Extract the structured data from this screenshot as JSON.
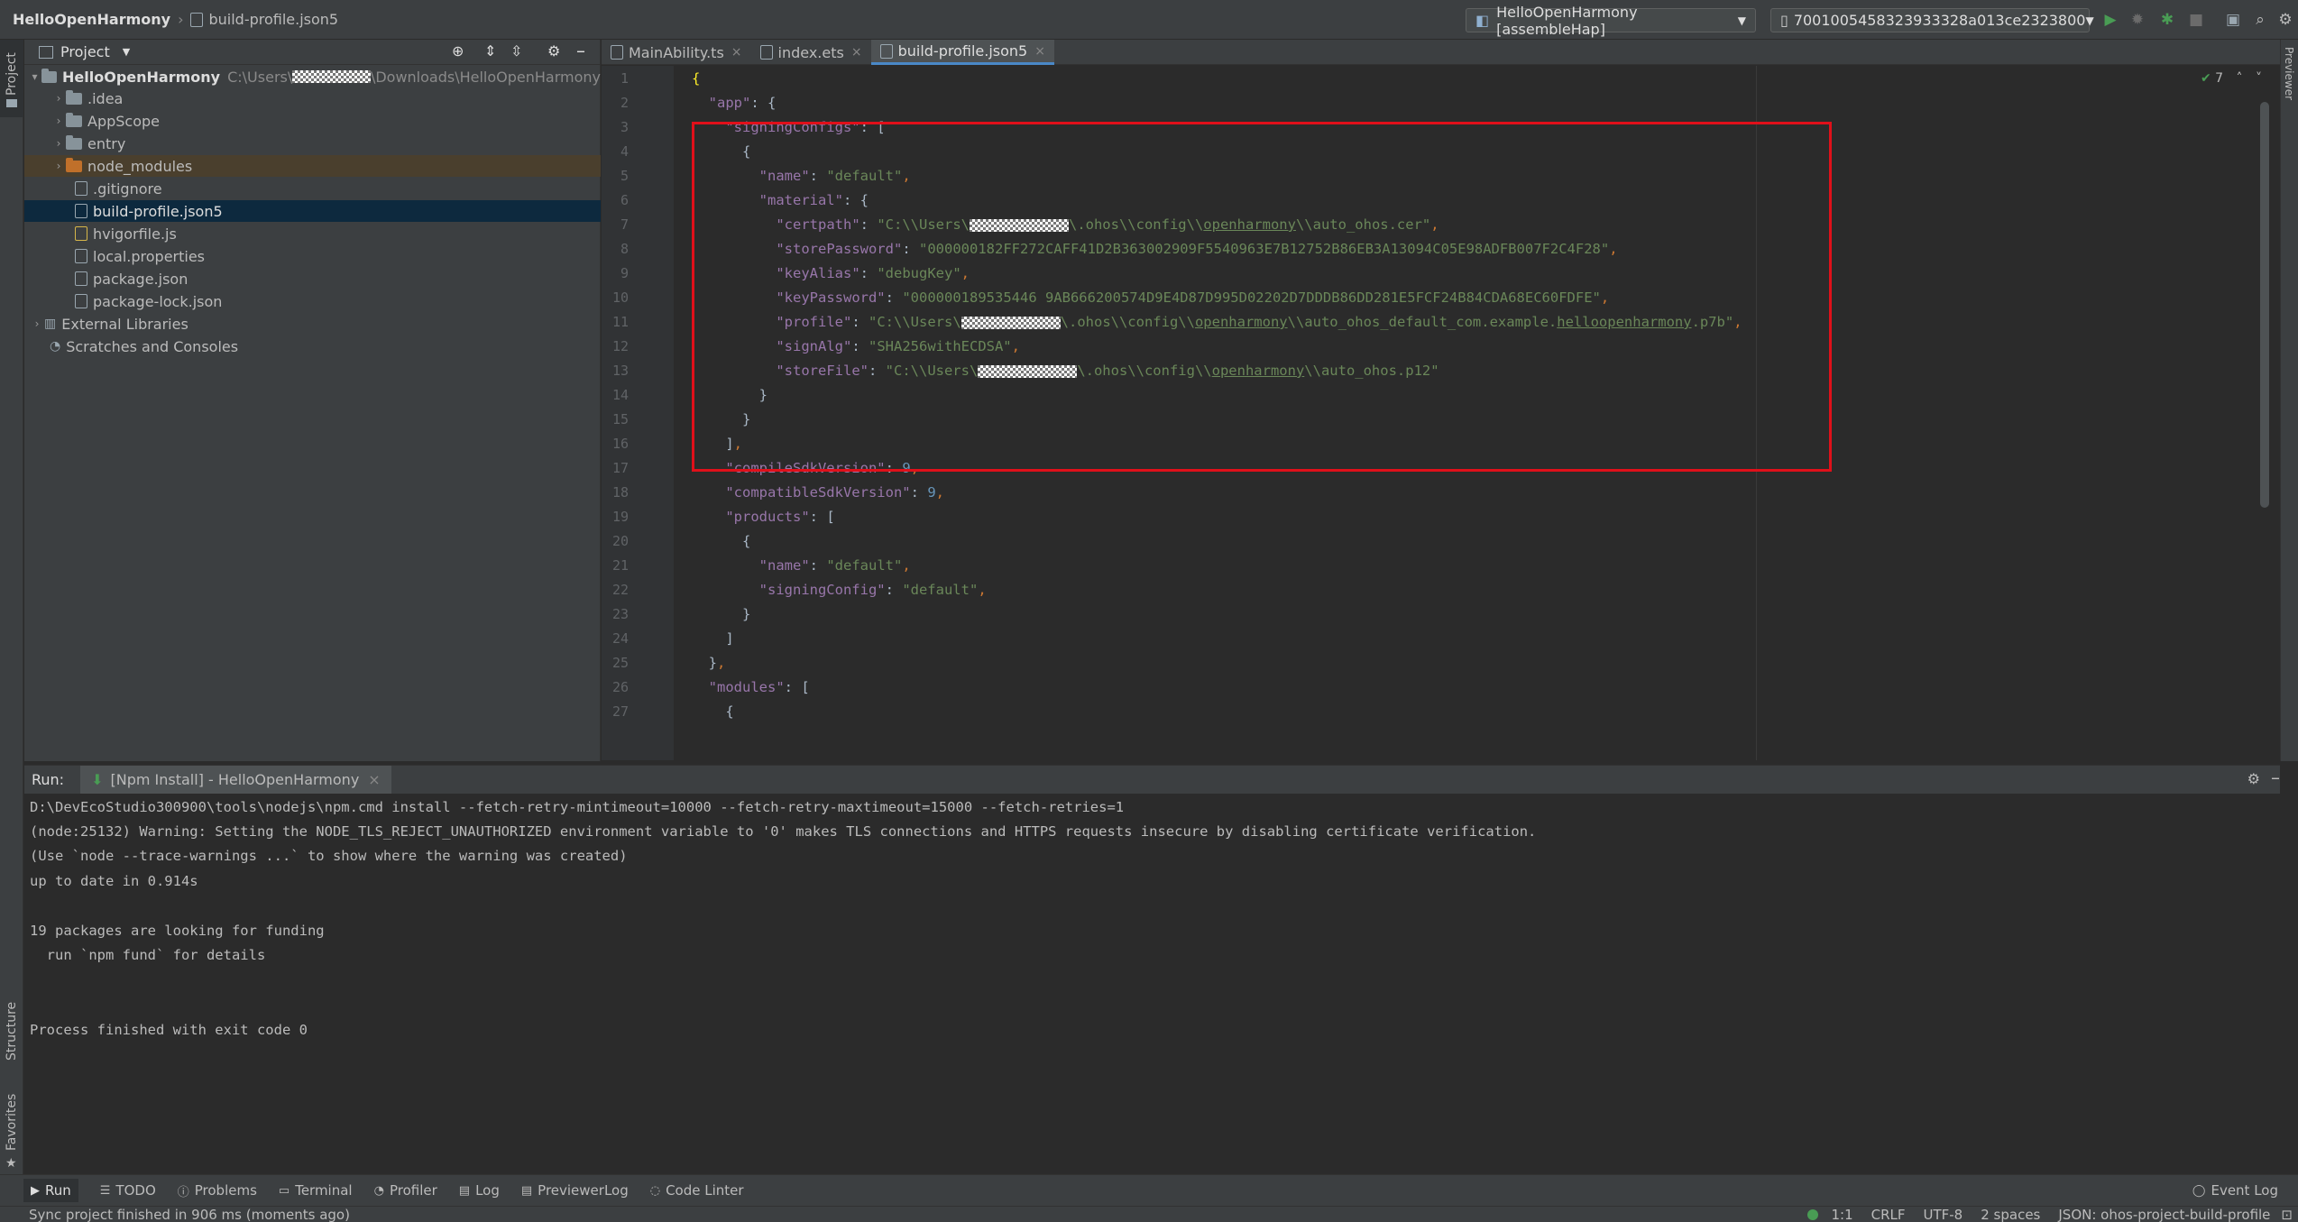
{
  "nav": {
    "project": "HelloOpenHarmony",
    "file": "build-profile.json5",
    "run_config": "HelloOpenHarmony [assembleHap]",
    "device": "7001005458323933328a013ce2323800"
  },
  "left_stripe": {
    "project": "Project",
    "structure": "Structure",
    "favorites": "Favorites"
  },
  "right_stripe": {
    "previewer": "Previewer"
  },
  "project_panel": {
    "title": "Project",
    "root_name": "HelloOpenHarmony",
    "root_path_prefix": "C:\\Users\\",
    "root_path_suffix": "\\Downloads\\HelloOpenHarmony",
    "items": [
      {
        "label": ".idea"
      },
      {
        "label": "AppScope"
      },
      {
        "label": "entry"
      },
      {
        "label": "node_modules"
      },
      {
        "label": ".gitignore"
      },
      {
        "label": "build-profile.json5"
      },
      {
        "label": "hvigorfile.js"
      },
      {
        "label": "local.properties"
      },
      {
        "label": "package.json"
      },
      {
        "label": "package-lock.json"
      },
      {
        "label": "External Libraries"
      },
      {
        "label": "Scratches and Consoles"
      }
    ]
  },
  "tabs": [
    {
      "label": "MainAbility.ts"
    },
    {
      "label": "index.ets"
    },
    {
      "label": "build-profile.json5"
    }
  ],
  "editor": {
    "inspection_count": "7",
    "line_numbers": [
      "1",
      "2",
      "3",
      "4",
      "5",
      "6",
      "7",
      "8",
      "9",
      "10",
      "11",
      "12",
      "13",
      "14",
      "15",
      "16",
      "17",
      "18",
      "19",
      "20",
      "21",
      "22",
      "23",
      "24",
      "25",
      "26",
      "27"
    ],
    "store_password": "000000182FF272CAFF41D2B363002909F5540963E7B12752B86EB3A13094C05E98ADFB007F2C4F28",
    "key_password": "000000189535446 9AB666200574D9E4D87D995D02202D7DDDB86DD281E5FCF24B84CDA68EC60FDFE"
  },
  "run": {
    "label": "Run:",
    "tab": "[Npm Install] - HelloOpenHarmony",
    "lines": [
      "D:\\DevEcoStudio300900\\tools\\nodejs\\npm.cmd install --fetch-retry-mintimeout=10000 --fetch-retry-maxtimeout=15000 --fetch-retries=1",
      "(node:25132) Warning: Setting the NODE_TLS_REJECT_UNAUTHORIZED environment variable to '0' makes TLS connections and HTTPS requests insecure by disabling certificate verification.",
      "(Use `node --trace-warnings ...` to show where the warning was created)",
      "up to date in 0.914s",
      "",
      "19 packages are looking for funding",
      "  run `npm fund` for details",
      "",
      "",
      "Process finished with exit code 0"
    ]
  },
  "bottom_tools": [
    {
      "label": "Run"
    },
    {
      "label": "TODO"
    },
    {
      "label": "Problems"
    },
    {
      "label": "Terminal"
    },
    {
      "label": "Profiler"
    },
    {
      "label": "Log"
    },
    {
      "label": "PreviewerLog"
    },
    {
      "label": "Code Linter"
    }
  ],
  "event_log": "Event Log",
  "status": {
    "message": "Sync project finished in 906 ms (moments ago)",
    "position": "1:1",
    "line_sep": "CRLF",
    "encoding": "UTF-8",
    "indent": "2 spaces",
    "schema": "JSON: ohos-project-build-profile"
  },
  "colors": {
    "accent": "#4a88c7",
    "highlight_box": "#e0101a",
    "run_green": "#499c54"
  }
}
